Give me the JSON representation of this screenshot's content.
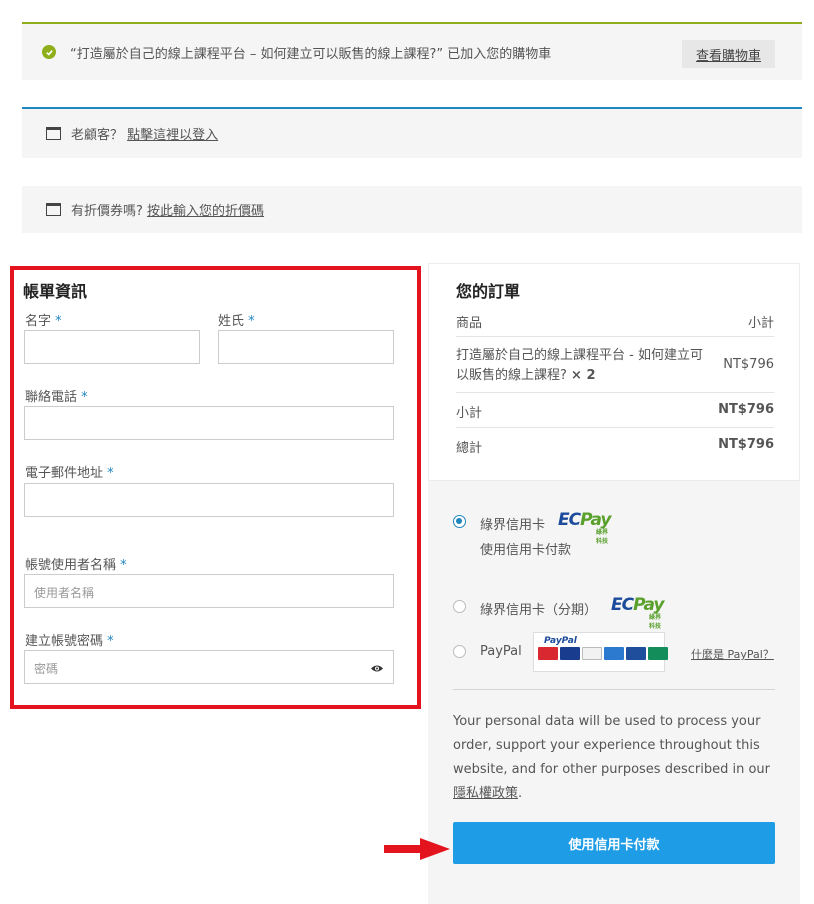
{
  "notices": {
    "cart_added": "“打造屬於自己的線上課程平台 – 如何建立可以販售的線上課程?” 已加入您的購物車",
    "view_cart": "查看購物車",
    "returning_prefix": "老顧客？",
    "returning_link": "點擊這裡以登入",
    "coupon_prefix": "有折價券嗎?",
    "coupon_link": "按此輸入您的折價碼"
  },
  "billing": {
    "title": "帳單資訊",
    "required_mark": "*",
    "first_name_label": "名字",
    "last_name_label": "姓氏",
    "phone_label": "聯絡電話",
    "email_label": "電子郵件地址",
    "username_label": "帳號使用者名稱",
    "username_placeholder": "使用者名稱",
    "password_label": "建立帳號密碼",
    "password_placeholder": "密碼"
  },
  "order": {
    "title": "您的訂單",
    "col_product": "商品",
    "col_subtotal": "小計",
    "item_name_line1": "打造屬於自己的線上課程平台 - 如何建立可",
    "item_name_line2": "以販售的線上課程?",
    "item_qty": "× 2",
    "item_price": "NT$796",
    "subtotal_label": "小計",
    "subtotal_value": "NT$796",
    "total_label": "總計",
    "total_value": "NT$796"
  },
  "payment": {
    "option_credit": "綠界信用卡",
    "option_credit_desc": "使用信用卡付款",
    "option_installment": "綠界信用卡（分期）",
    "option_paypal": "PayPal",
    "ecpay_ec": "EC",
    "ecpay_pay": "Pay",
    "ecpay_sub": "綠界科技",
    "paypal_logo_text": "PayPal",
    "whats_paypal": "什麼是 PayPal？",
    "selected": "credit"
  },
  "privacy": {
    "text": "Your personal data will be used to process your order, support your experience throughout this website, and for other purposes described in our",
    "link": "隱私權政策",
    "end": "."
  },
  "place_order": "使用信用卡付款",
  "colors": {
    "accent": "#1e9ce5",
    "success": "#8fae1b",
    "highlight_red": "#e3141d"
  }
}
